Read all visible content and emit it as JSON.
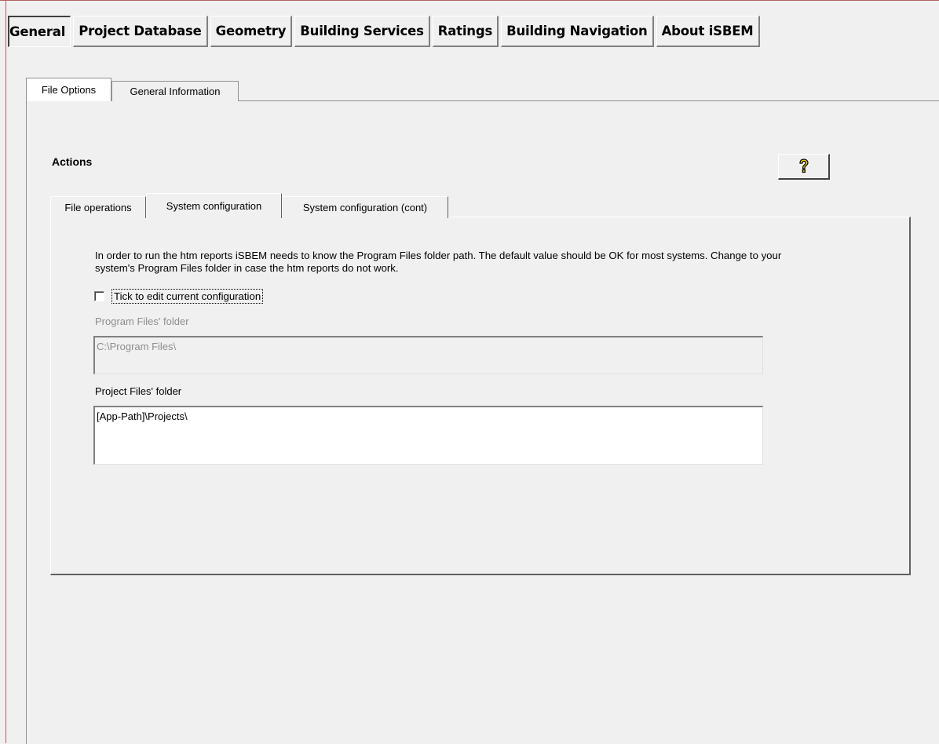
{
  "main_tabs": [
    {
      "label": "General",
      "active": true
    },
    {
      "label": "Project Database",
      "active": false
    },
    {
      "label": "Geometry",
      "active": false
    },
    {
      "label": "Building Services",
      "active": false
    },
    {
      "label": "Ratings",
      "active": false
    },
    {
      "label": "Building Navigation",
      "active": false
    },
    {
      "label": "About iSBEM",
      "active": false
    }
  ],
  "sub_tabs": [
    {
      "label": "File Options",
      "active": true
    },
    {
      "label": "General Information",
      "active": false
    }
  ],
  "actions": {
    "heading": "Actions",
    "help_icon": "question-mark-icon"
  },
  "inner_tabs": [
    {
      "label": "File operations",
      "active": false
    },
    {
      "label": "System configuration",
      "active": true
    },
    {
      "label": "System configuration (cont)",
      "active": false
    }
  ],
  "system_config": {
    "info_text": "In order to run the htm reports iSBEM needs to know the Program Files folder path. The default value should be OK for most systems. Change to your system's Program Files folder in case the htm reports do not work.",
    "tick_label": "Tick to edit current configuration",
    "tick_checked": false,
    "program_files_label": "Program Files' folder",
    "program_files_value": "C:\\Program Files\\",
    "project_files_label": "Project Files' folder",
    "project_files_value": "[App-Path]\\Projects\\"
  },
  "colors": {
    "window_bg": "#f0f0f0",
    "frame_accent": "#b06060",
    "help_icon_color": "#f2d600",
    "disabled_text": "#8d8d8d"
  }
}
